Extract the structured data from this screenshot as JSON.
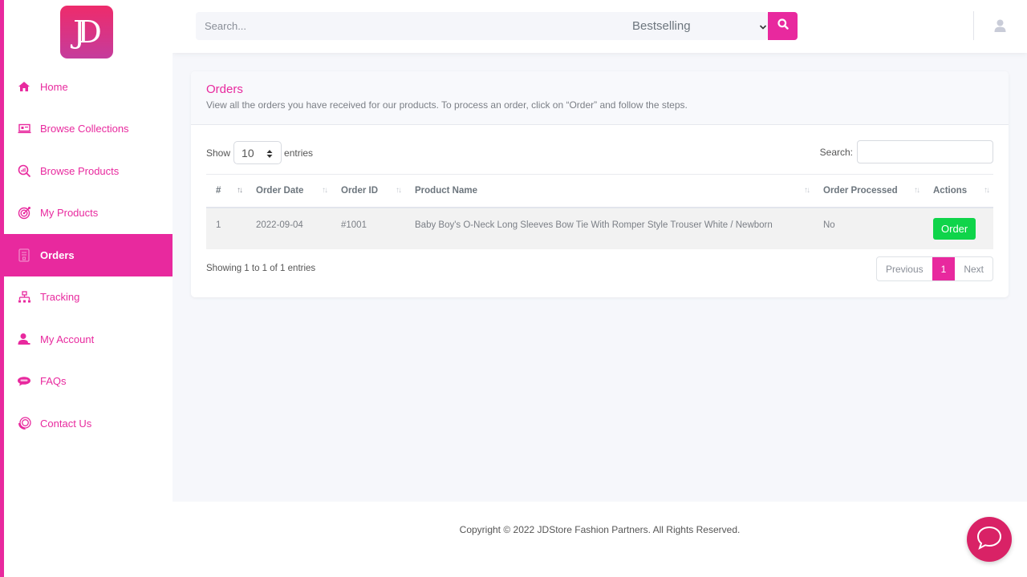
{
  "brand": {
    "logo_text": "JD",
    "accent": "#e8299e"
  },
  "sidebar": {
    "items": [
      {
        "label": "Home",
        "icon": "home-icon",
        "active": false
      },
      {
        "label": "Browse Collections",
        "icon": "laptop-icon",
        "active": false
      },
      {
        "label": "Browse Products",
        "icon": "search-chart-icon",
        "active": false
      },
      {
        "label": "My Products",
        "icon": "target-icon",
        "active": false
      },
      {
        "label": "Orders",
        "icon": "document-icon",
        "active": true
      },
      {
        "label": "Tracking",
        "icon": "sitemap-icon",
        "active": false
      },
      {
        "label": "My Account",
        "icon": "user-icon",
        "active": false
      },
      {
        "label": "FAQs",
        "icon": "chat-bubbles-icon",
        "active": false
      },
      {
        "label": "Contact Us",
        "icon": "support-icon",
        "active": false
      }
    ]
  },
  "header": {
    "search_placeholder": "Search...",
    "sort_selected": "Bestselling"
  },
  "card": {
    "title": "Orders",
    "subtitle": "View all the orders you have received for our products. To process an order, click on “Order” and follow the steps."
  },
  "table_controls": {
    "show_label": "Show",
    "entries_label": "entries",
    "page_length": "10",
    "search_label": "Search:"
  },
  "table": {
    "columns": [
      "#",
      "Order Date",
      "Order ID",
      "Product Name",
      "Order Processed",
      "Actions"
    ],
    "rows": [
      {
        "num": "1",
        "date": "2022-09-04",
        "order_id": "#1001",
        "product": "Baby Boy's O-Neck Long Sleeves Bow Tie With Romper Style Trouser White / Newborn",
        "processed": "No",
        "action": "Order"
      }
    ],
    "action_color": "#0fd44a"
  },
  "pagination": {
    "info": "Showing 1 to 1 of 1 entries",
    "previous": "Previous",
    "current": "1",
    "next": "Next"
  },
  "footer": {
    "copyright": "Copyright © 2022 JDStore Fashion Partners. All Rights Reserved."
  }
}
